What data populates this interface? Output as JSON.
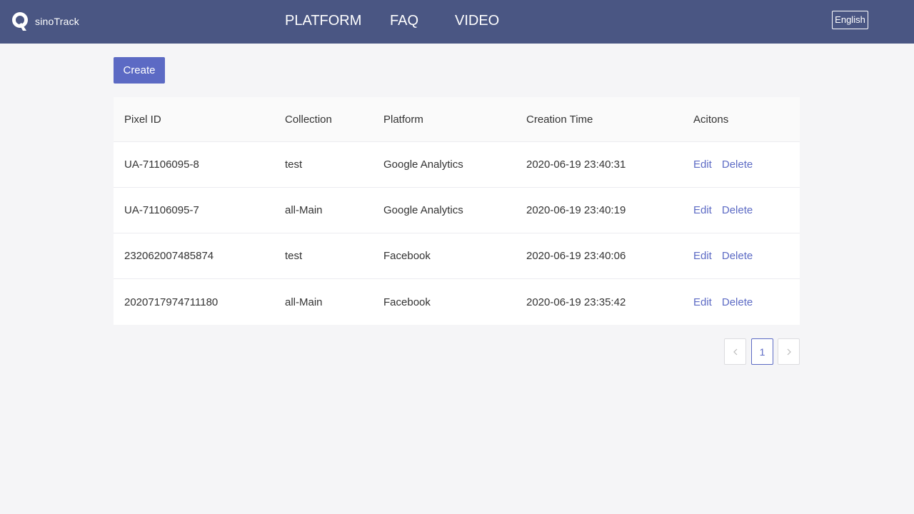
{
  "header": {
    "brand": "sinoTrack",
    "nav": [
      "PLATFORM",
      "FAQ",
      "VIDEO"
    ],
    "language": "English"
  },
  "toolbar": {
    "create_label": "Create"
  },
  "table": {
    "columns": [
      "Pixel ID",
      "Collection",
      "Platform",
      "Creation Time",
      "Acitons"
    ],
    "rows": [
      [
        "UA-71106095-8",
        "test",
        "Google Analytics",
        "2020-06-19 23:40:31"
      ],
      [
        "UA-71106095-7",
        "all-Main",
        "Google Analytics",
        "2020-06-19 23:40:19"
      ],
      [
        "232062007485874",
        "test",
        "Facebook",
        "2020-06-19 23:40:06"
      ],
      [
        "2020717974711180",
        "all-Main",
        "Facebook",
        "2020-06-19 23:35:42"
      ]
    ],
    "actions": {
      "edit": "Edit",
      "delete": "Delete"
    }
  },
  "pagination": {
    "current": "1"
  },
  "colors": {
    "header_bg": "#4a5683",
    "accent": "#5c6ac4"
  },
  "icons": {
    "logo": "q-logo-icon",
    "prev": "chevron-left-icon",
    "next": "chevron-right-icon"
  }
}
